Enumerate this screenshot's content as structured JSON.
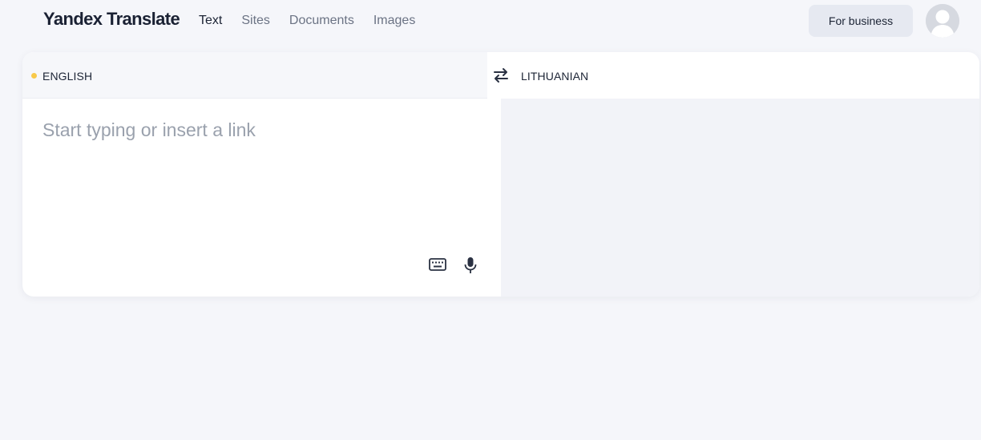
{
  "header": {
    "logo": "Yandex Translate",
    "nav": [
      {
        "label": "Text",
        "active": true
      },
      {
        "label": "Sites",
        "active": false
      },
      {
        "label": "Documents",
        "active": false
      },
      {
        "label": "Images",
        "active": false
      }
    ],
    "business_button": "For business",
    "avatar_icon": "user-avatar-icon"
  },
  "translator": {
    "source_language": "ENGLISH",
    "target_language": "LITHUANIAN",
    "swap_icon": "swap-arrows-icon",
    "source_placeholder": "Start typing or insert a link",
    "source_value": "",
    "keyboard_icon": "keyboard-icon",
    "microphone_icon": "microphone-icon",
    "detected_dot_color": "#f8c94a"
  }
}
